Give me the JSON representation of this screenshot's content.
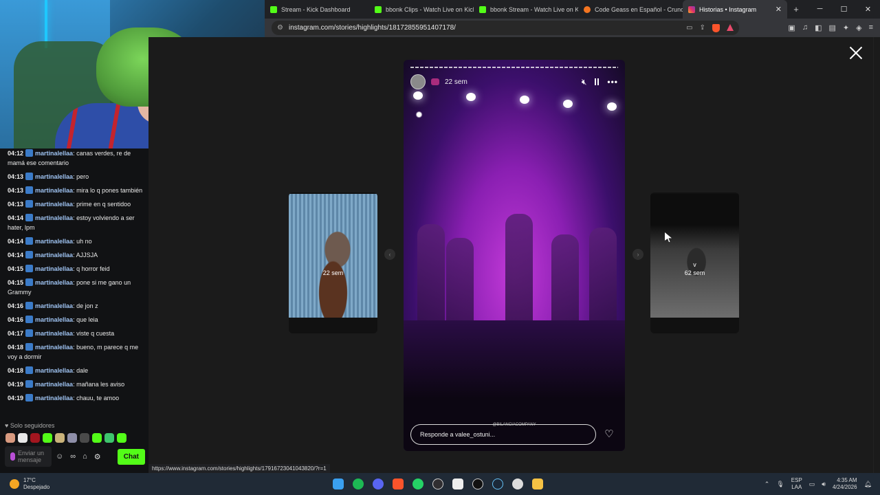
{
  "browser": {
    "tabs": [
      {
        "label": "Stream - Kick Dashboard",
        "icon": "kick-icon",
        "color": "#53fc18"
      },
      {
        "label": "bbonk Clips - Watch Live on Kick",
        "icon": "kick-icon",
        "color": "#53fc18"
      },
      {
        "label": "bbonk Stream - Watch Live on Ki",
        "icon": "kick-icon",
        "color": "#53fc18"
      },
      {
        "label": "Code Geass en Español - Crunchy",
        "icon": "crunchyroll-icon",
        "color": "#f47521"
      },
      {
        "label": "Historias • Instagram",
        "icon": "instagram-icon",
        "color": "#e1306c"
      }
    ],
    "new_tab": "+",
    "url": "instagram.com/stories/highlights/18172855951407178/"
  },
  "chat": {
    "messages": [
      {
        "time": "04:12",
        "user": "martinalellaa",
        "text": "canas verdes, re de mamá ese comentario"
      },
      {
        "time": "04:13",
        "user": "martinalellaa",
        "text": "pero"
      },
      {
        "time": "04:13",
        "user": "martinalellaa",
        "text": "mira lo q pones también"
      },
      {
        "time": "04:13",
        "user": "martinalellaa",
        "text": "prime en q sentidoo"
      },
      {
        "time": "04:14",
        "user": "martinalellaa",
        "text": "estoy volviendo a ser hater, lpm"
      },
      {
        "time": "04:14",
        "user": "martinalellaa",
        "text": "uh no"
      },
      {
        "time": "04:14",
        "user": "martinalellaa",
        "text": "AJJSJA"
      },
      {
        "time": "04:15",
        "user": "martinalellaa",
        "text": "q horror feid"
      },
      {
        "time": "04:15",
        "user": "martinalellaa",
        "text": "pone si me gano un Grammy"
      },
      {
        "time": "04:16",
        "user": "martinalellaa",
        "text": "de jon z"
      },
      {
        "time": "04:16",
        "user": "martinalellaa",
        "text": "que leia"
      },
      {
        "time": "04:17",
        "user": "martinalellaa",
        "text": "viste q cuesta"
      },
      {
        "time": "04:18",
        "user": "martinalellaa",
        "text": "bueno, m parece q me voy a dormir"
      },
      {
        "time": "04:18",
        "user": "martinalellaa",
        "text": "dale"
      },
      {
        "time": "04:19",
        "user": "martinalellaa",
        "text": "mañana les aviso"
      },
      {
        "time": "04:19",
        "user": "martinalellaa",
        "text": "chauu, te amoo"
      }
    ],
    "mode": "♥ Solo seguidores",
    "input_placeholder": "Enviar un mensaje",
    "send_label": "Chat",
    "accent": "#53fc18"
  },
  "story": {
    "time": "22 sem",
    "watermark": "@BILANCIACOMPANY",
    "reply_placeholder": "Responde a valee_ostuni...",
    "left_preview_label": "22 sem",
    "right_preview_label": "62 sem",
    "right_preview_caption": "v"
  },
  "status_url": "https://www.instagram.com/stories/highlights/17916723041043820/?r=1",
  "taskbar": {
    "temperature": "17°C",
    "weather": "Despejado",
    "language": "ESP",
    "layout": "LAA",
    "time": "4:35 AM",
    "date": "4/24/2026"
  }
}
